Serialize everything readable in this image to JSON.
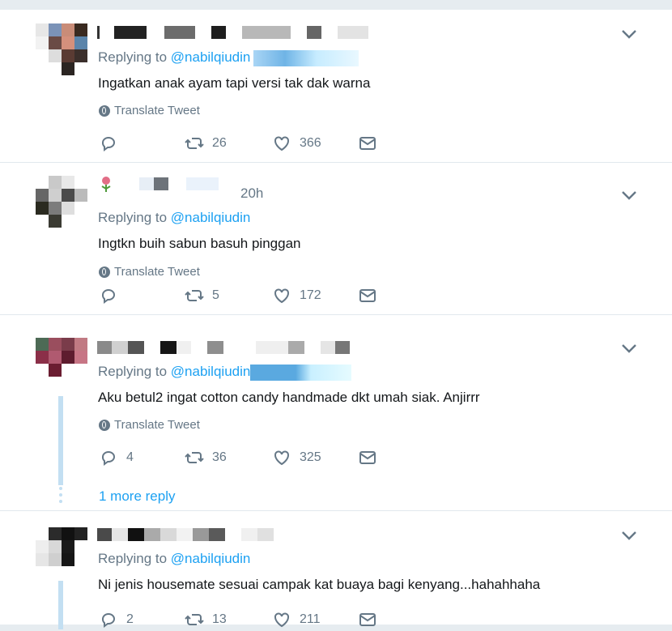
{
  "common": {
    "replying_prefix": "Replying to ",
    "translate_label": "Translate Tweet",
    "icons": {
      "reply": "reply-icon",
      "retweet": "retweet-icon",
      "like": "heart-icon",
      "dm": "envelope-icon",
      "more": "chevron-down-icon",
      "translate": "globe-icon"
    },
    "colors": {
      "link": "#1da1f2",
      "muted": "#657786",
      "divider": "#e1e8ed",
      "thread": "#c3dff2"
    }
  },
  "tweets": [
    {
      "handle": "@nabilqiudin",
      "time": "",
      "text": "Ingatkan anak ayam tapi versi tak dak warna",
      "translate": "Translate Tweet",
      "replies": "",
      "retweets": "26",
      "likes": "366"
    },
    {
      "handle": "@nabilqiudin",
      "time": "20h",
      "text": "Ingtkn buih sabun basuh pinggan",
      "translate": "Translate Tweet",
      "replies": "",
      "retweets": "5",
      "likes": "172"
    },
    {
      "handle": "@nabilqiudin",
      "time": "",
      "text": "Aku betul2 ingat cotton candy handmade dkt umah siak. Anjirrr",
      "translate": "Translate Tweet",
      "replies": "4",
      "retweets": "36",
      "likes": "325",
      "more_replies": "1 more reply"
    },
    {
      "handle": "@nabilqiudin",
      "time": "",
      "text": "Ni jenis housemate sesuai campak kat buaya bagi kenyang...hahahhaha",
      "replies": "2",
      "retweets": "13",
      "likes": "211"
    }
  ]
}
